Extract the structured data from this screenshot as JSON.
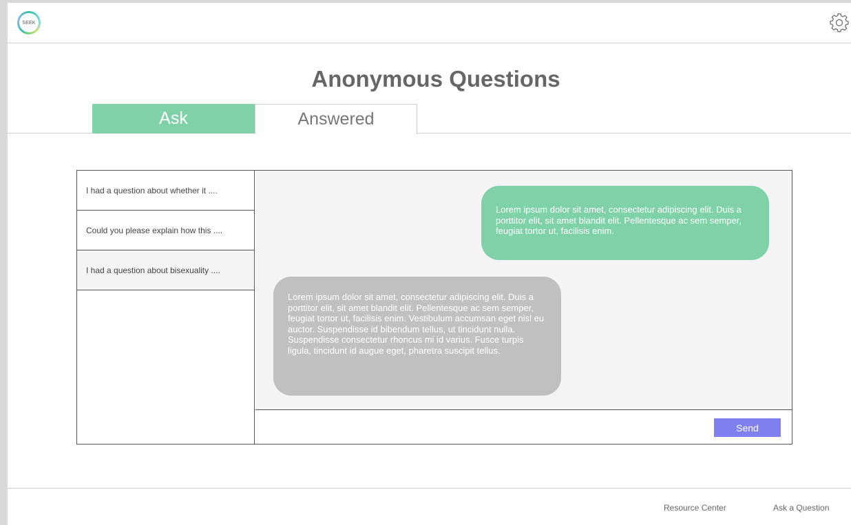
{
  "header": {
    "logo_text": "SEEK",
    "settings_icon": "gear-icon"
  },
  "page": {
    "title": "Anonymous Questions"
  },
  "tabs": [
    {
      "label": "Ask",
      "active": true
    },
    {
      "label": "Answered",
      "active": false
    }
  ],
  "questions": [
    {
      "label": "I had a question about whether it ....",
      "selected": false
    },
    {
      "label": "Could you please explain how this ....",
      "selected": false
    },
    {
      "label": "I had a question about bisexuality ....",
      "selected": true
    }
  ],
  "chat": {
    "sent_message": "Lorem ipsum dolor sit amet, consectetur adipiscing elit. Duis a porttitor elit, sit amet blandit elit. Pellentesque ac sem semper, feugiat tortor ut, facilisis enim.",
    "received_message": "Lorem ipsum dolor sit amet, consectetur adipiscing elit. Duis a porttitor elit, sit amet blandit elit. Pellentesque ac sem semper, feugiat tortor ut, facilisis enim. Vestibulum accumsan eget nisl eu auctor. Suspendisse id bibendum tellus, ut tincidunt nulla. Suspendisse consectetur rhoncus mi id varius. Fusce turpis ligula, tincidunt id augue eget, pharetra suscipit tellus."
  },
  "compose": {
    "input_value": "",
    "send_label": "Send"
  },
  "footer": {
    "resource_center": "Resource Center",
    "ask_question": "Ask a Question"
  },
  "colors": {
    "accent_green": "#7fd1a8",
    "send_button": "#8080f0",
    "received_bubble": "#c0c0c0"
  }
}
